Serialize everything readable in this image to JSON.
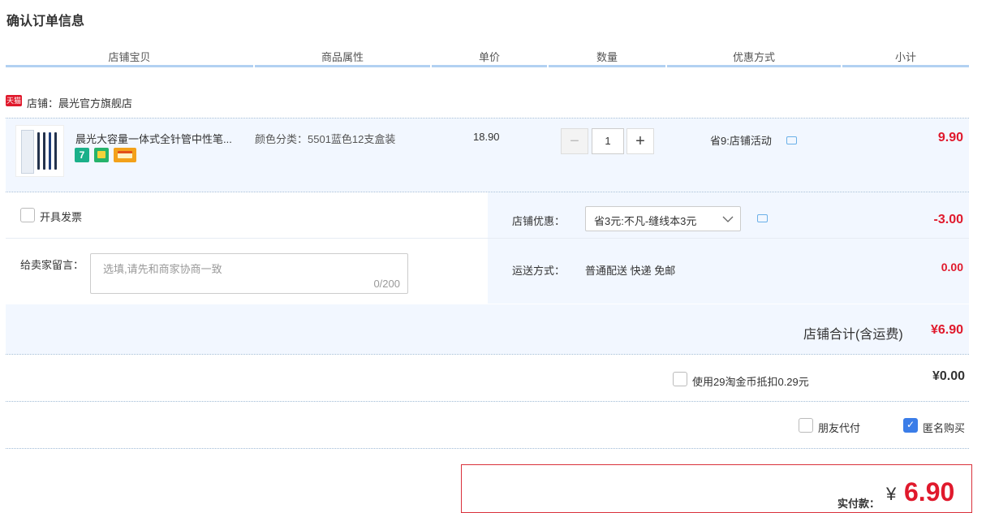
{
  "page_title": "确认订单信息",
  "columns": [
    "店铺宝贝",
    "商品属性",
    "单价",
    "数量",
    "优惠方式",
    "小计"
  ],
  "shop": {
    "tag": "天猫",
    "label": "店铺：晨光官方旗舰店"
  },
  "item": {
    "name": "晨光大容量一体式全针管中性笔...",
    "attribute": "颜色分类：5501蓝色12支盒装",
    "price": "18.90",
    "quantity": "1",
    "minus": "−",
    "plus": "+",
    "discount": "省9:店铺活动",
    "subtotal": "9.90",
    "badges": [
      "7",
      "",
      ""
    ]
  },
  "invoice": {
    "label": "开具发票"
  },
  "message": {
    "label": "给卖家留言：",
    "placeholder": "选填,请先和商家协商一致",
    "counter": "0/200"
  },
  "shop_discount": {
    "label": "店铺优惠：",
    "value": "省3元:不凡-缝线本3元",
    "amount": "-3.00"
  },
  "shipping": {
    "label": "运送方式：",
    "value": "普通配送 快递 免邮",
    "amount": "0.00"
  },
  "shop_total": {
    "label": "店铺合计(含运费)",
    "amount": "¥6.90"
  },
  "coins": {
    "label": "使用29淘金币抵扣0.29元",
    "amount": "¥0.00"
  },
  "options": {
    "friend_pay": "朋友代付",
    "anonymous": "匿名购买",
    "check": "✓"
  },
  "payment": {
    "label": "实付款：",
    "currency": "¥",
    "amount": "6.90"
  },
  "colors": {
    "accent_red": "#e0192c",
    "row_bg": "#f2f7ff",
    "header_line": "#b2d1f2",
    "checkbox_blue": "#3b7de8"
  },
  "icons": [
    "tmall-icon",
    "product-thumbnail",
    "chat-icon",
    "chevron-down-icon",
    "checkbox-icon"
  ]
}
